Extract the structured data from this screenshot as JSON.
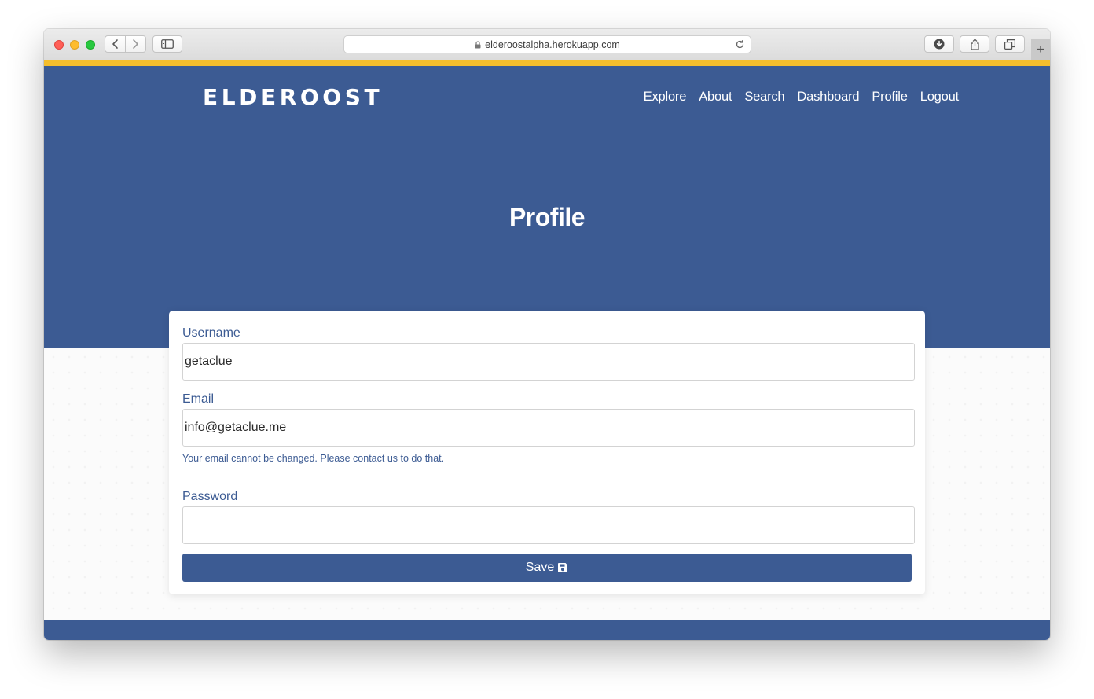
{
  "browser": {
    "url": "elderoostalpha.herokuapp.com",
    "new_tab_label": "+"
  },
  "site": {
    "brand": "ELDEROOST",
    "nav": [
      "Explore",
      "About",
      "Search",
      "Dashboard",
      "Profile",
      "Logout"
    ],
    "colors": {
      "primary": "#3c5b93",
      "accent": "#f5be2d"
    }
  },
  "page": {
    "title": "Profile"
  },
  "form": {
    "username_label": "Username",
    "username_value": "getaclue",
    "email_label": "Email",
    "email_value": "info@getaclue.me",
    "email_help": "Your email cannot be changed. Please contact us to do that.",
    "password_label": "Password",
    "password_value": "",
    "save_label": "Save"
  },
  "icons": {
    "lock": "lock-icon",
    "reload": "reload-icon",
    "save": "floppy-disk-icon"
  }
}
